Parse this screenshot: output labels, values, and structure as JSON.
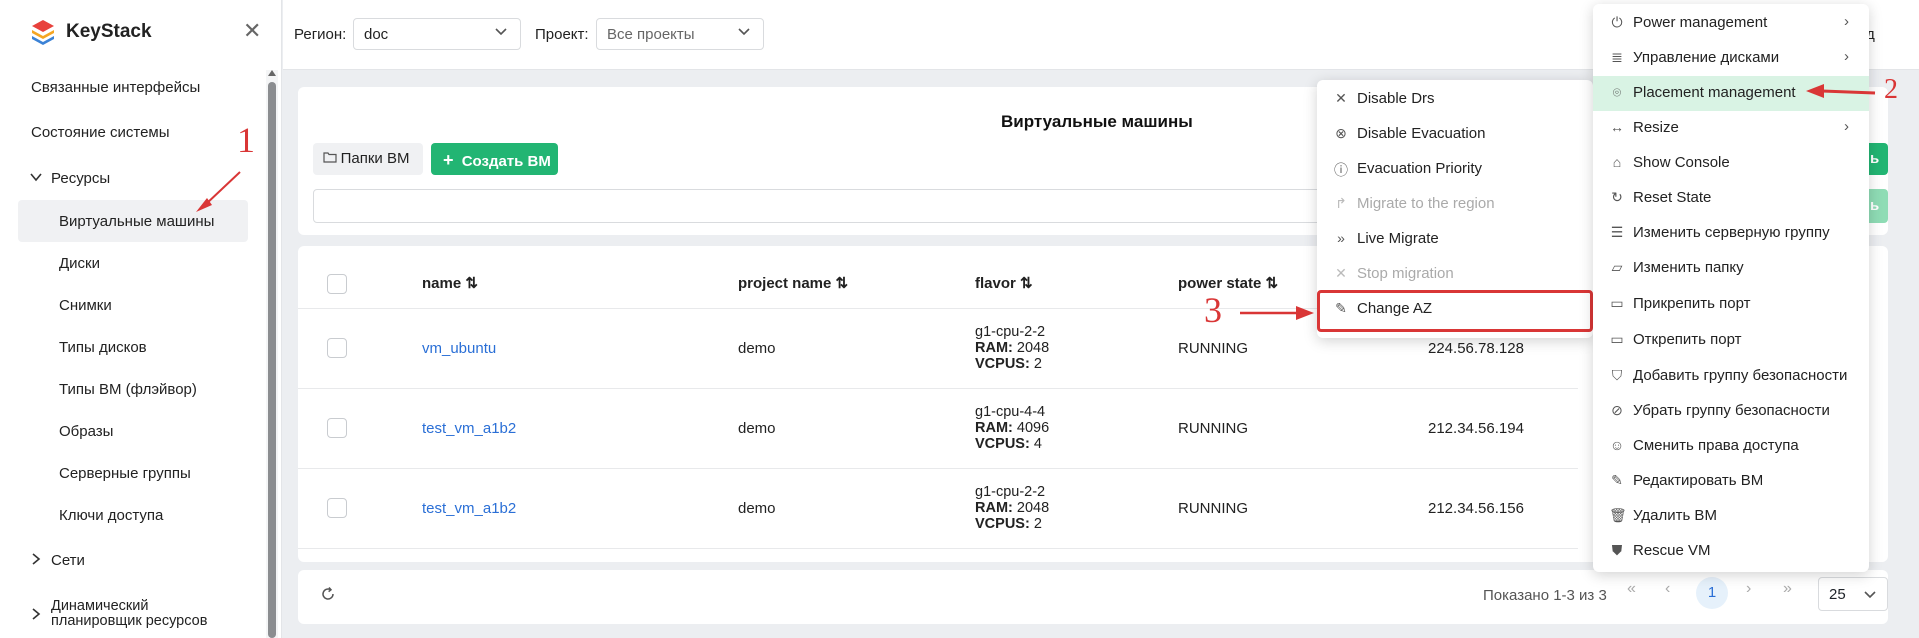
{
  "app": {
    "name": "KeyStack"
  },
  "sidebar": {
    "items": [
      {
        "label": "Связанные интерфейсы"
      },
      {
        "label": "Состояние системы"
      },
      {
        "label": "Ресурсы"
      },
      {
        "label": "Виртуальные машины"
      },
      {
        "label": "Диски"
      },
      {
        "label": "Снимки"
      },
      {
        "label": "Типы дисков"
      },
      {
        "label": "Типы ВМ (флэйвор)"
      },
      {
        "label": "Образы"
      },
      {
        "label": "Серверные группы"
      },
      {
        "label": "Ключи доступа"
      },
      {
        "label": "Сети"
      },
      {
        "label": "Динамический планировщик ресурсов"
      }
    ]
  },
  "topbar": {
    "region_label": "Регион:",
    "region_value": "doc",
    "project_label": "Проект:",
    "project_value": "Все проекты",
    "right_partial": "од"
  },
  "page": {
    "title": "Виртуальные машины",
    "folders_button": "Папки ВМ",
    "create_button": "Создать ВМ",
    "create_partial": "ь"
  },
  "table": {
    "columns": [
      "name",
      "project name",
      "flavor",
      "power state"
    ],
    "rows": [
      {
        "name": "vm_ubuntu",
        "project": "demo",
        "flavor": "g1-cpu-2-2",
        "ram_label": "RAM:",
        "ram": "2048",
        "vcpus_label": "VCPUS:",
        "vcpus": "2",
        "state": "RUNNING",
        "ip": "224.56.78.128"
      },
      {
        "name": "test_vm_a1b2",
        "project": "demo",
        "flavor": "g1-cpu-4-4",
        "ram_label": "RAM:",
        "ram": "4096",
        "vcpus_label": "VCPUS:",
        "vcpus": "4",
        "state": "RUNNING",
        "ip": "212.34.56.194"
      },
      {
        "name": "test_vm_a1b2",
        "project": "demo",
        "flavor": "g1-cpu-2-2",
        "ram_label": "RAM:",
        "ram": "2048",
        "vcpus_label": "VCPUS:",
        "vcpus": "2",
        "state": "RUNNING",
        "ip": "212.34.56.156"
      }
    ]
  },
  "pagination": {
    "summary": "Показано 1-3 из 3",
    "current": "1",
    "page_size": "25"
  },
  "submenu": {
    "items": [
      {
        "label": "Disable Drs",
        "icon": "x-icon",
        "disabled": false
      },
      {
        "label": "Disable Evacuation",
        "icon": "x-circle-icon",
        "disabled": false
      },
      {
        "label": "Evacuation Priority",
        "icon": "info-circle-icon",
        "disabled": false
      },
      {
        "label": "Migrate to the region",
        "icon": "arrow-forward-icon",
        "disabled": true
      },
      {
        "label": "Live Migrate",
        "icon": "double-chevron-right-icon",
        "disabled": false
      },
      {
        "label": "Stop migration",
        "icon": "x-icon",
        "disabled": true
      },
      {
        "label": "Change AZ",
        "icon": "pencil-icon",
        "disabled": false
      }
    ]
  },
  "actions_menu": {
    "items": [
      {
        "label": "Power management",
        "icon": "power-icon"
      },
      {
        "label": "Управление дисками",
        "icon": "database-icon"
      },
      {
        "label": "Placement management",
        "icon": "map-pin-icon"
      },
      {
        "label": "Resize",
        "icon": "resize-icon"
      },
      {
        "label": "Show Console",
        "icon": "console-icon"
      },
      {
        "label": "Reset State",
        "icon": "refresh-icon"
      },
      {
        "label": "Изменить серверную группу",
        "icon": "server-group-icon"
      },
      {
        "label": "Изменить папку",
        "icon": "folder-open-icon"
      },
      {
        "label": "Прикрепить порт",
        "icon": "port-attach-icon"
      },
      {
        "label": "Открепить порт",
        "icon": "port-detach-icon"
      },
      {
        "label": "Добавить группу безопасности",
        "icon": "shield-icon"
      },
      {
        "label": "Убрать группу безопасности",
        "icon": "ban-icon"
      },
      {
        "label": "Сменить права доступа",
        "icon": "user-key-icon"
      },
      {
        "label": "Редактировать ВМ",
        "icon": "pencil-icon"
      },
      {
        "label": "Удалить ВМ",
        "icon": "trash-icon"
      },
      {
        "label": "Rescue VM",
        "icon": "rescue-icon"
      }
    ]
  },
  "annotations": {
    "one": "1",
    "two": "2",
    "three": "3"
  },
  "colors": {
    "accent": "#22b573",
    "highlight": "#d9f3e4",
    "annotation": "#d93636",
    "link": "#2a6fd6"
  }
}
